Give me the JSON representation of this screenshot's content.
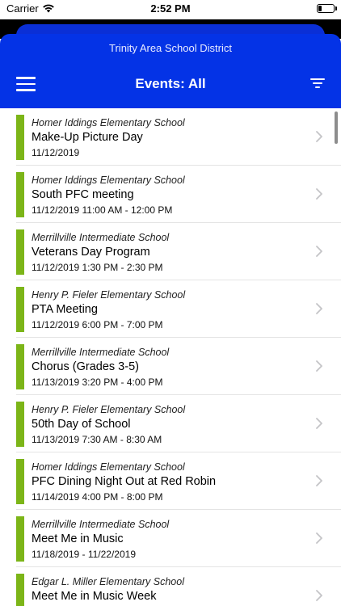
{
  "status_bar": {
    "carrier": "Carrier",
    "time": "2:52 PM",
    "battery_level": 0.2
  },
  "header": {
    "district": "Trinity Area School District",
    "title": "Events: All",
    "menu_icon": "hamburger-menu-icon",
    "filter_icon": "filter-icon"
  },
  "colors": {
    "header_blue": "#0433e6",
    "accent_green": "#7cb518"
  },
  "events": [
    {
      "school": "Homer Iddings Elementary School",
      "title": "Make-Up Picture Day",
      "date": "11/12/2019"
    },
    {
      "school": "Homer Iddings Elementary School",
      "title": "South PFC meeting",
      "date": "11/12/2019 11:00 AM - 12:00 PM"
    },
    {
      "school": "Merrillville Intermediate School",
      "title": "Veterans Day Program",
      "date": "11/12/2019 1:30 PM - 2:30 PM"
    },
    {
      "school": "Henry P. Fieler Elementary School",
      "title": "PTA Meeting",
      "date": "11/12/2019 6:00 PM - 7:00 PM"
    },
    {
      "school": "Merrillville Intermediate School",
      "title": "Chorus (Grades 3-5)",
      "date": "11/13/2019 3:20 PM - 4:00 PM"
    },
    {
      "school": "Henry P. Fieler Elementary School",
      "title": "50th Day of School",
      "date": "11/13/2019 7:30 AM - 8:30 AM"
    },
    {
      "school": "Homer Iddings Elementary School",
      "title": "PFC Dining Night Out at Red Robin",
      "date": "11/14/2019 4:00 PM - 8:00 PM"
    },
    {
      "school": "Merrillville Intermediate School",
      "title": "Meet Me in Music",
      "date": "11/18/2019 - 11/22/2019"
    },
    {
      "school": "Edgar L. Miller Elementary School",
      "title": "Meet Me in Music Week",
      "date": ""
    }
  ]
}
